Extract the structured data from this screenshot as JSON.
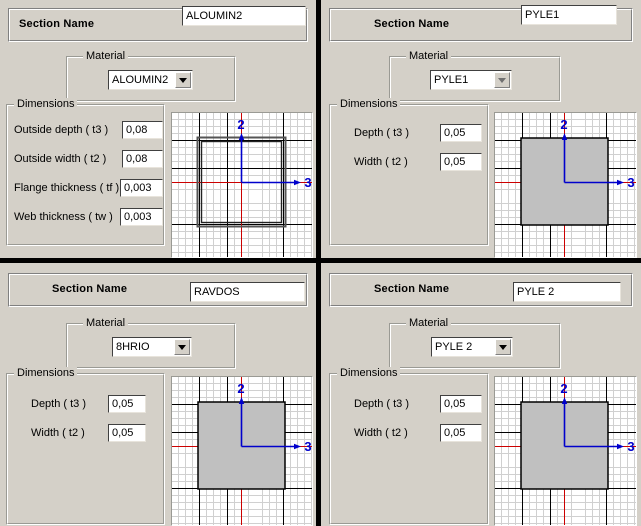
{
  "app": {
    "panel_count": 4,
    "background_color": "#d4d0c8",
    "divider_color": "#000000",
    "axis_label_color": "#0000c0",
    "shape_fill_color": "#c0c0c0"
  },
  "panels": [
    {
      "id": "top-left",
      "section_name_label": "Section Name",
      "section_name_value": "ALOUMIN2",
      "material": {
        "group_title": "Material",
        "selected": "ALOUMIN2",
        "arrow_icon": "chevron-down-icon"
      },
      "dimensions": {
        "group_title": "Dimensions",
        "rows": [
          {
            "label": "Outside depth  ( t3 )",
            "value": "0,08"
          },
          {
            "label": "Outside width  ( t2 )",
            "value": "0,08"
          },
          {
            "label": "Flange thickness  ( tf )",
            "value": "0,003"
          },
          {
            "label": "Web thickness  ( tw )",
            "value": "0,003"
          }
        ]
      },
      "preview": {
        "shape": "hollow-rectangle",
        "axis_2_label": "2",
        "axis_3_label": "3"
      }
    },
    {
      "id": "top-right",
      "section_name_label": "Section Name",
      "section_name_value": "PYLE1",
      "material": {
        "group_title": "Material",
        "selected": "PYLE1",
        "arrow_icon": "chevron-down-icon"
      },
      "dimensions": {
        "group_title": "Dimensions",
        "rows": [
          {
            "label": "Depth  ( t3 )",
            "value": "0,05"
          },
          {
            "label": "Width  ( t2 )",
            "value": "0,05"
          }
        ]
      },
      "preview": {
        "shape": "solid-rectangle",
        "axis_2_label": "2",
        "axis_3_label": "3"
      }
    },
    {
      "id": "bottom-left",
      "section_name_label": "Section Name",
      "section_name_value": "RAVDOS",
      "material": {
        "group_title": "Material",
        "selected": "8HRIO",
        "arrow_icon": "chevron-down-icon"
      },
      "dimensions": {
        "group_title": "Dimensions",
        "rows": [
          {
            "label": "Depth  ( t3 )",
            "value": "0,05"
          },
          {
            "label": "Width  ( t2 )",
            "value": "0,05"
          }
        ]
      },
      "preview": {
        "shape": "solid-rectangle",
        "axis_2_label": "2",
        "axis_3_label": "3"
      }
    },
    {
      "id": "bottom-right",
      "section_name_label": "Section Name",
      "section_name_value": "PYLE 2",
      "material": {
        "group_title": "Material",
        "selected": "PYLE 2",
        "arrow_icon": "chevron-down-icon"
      },
      "dimensions": {
        "group_title": "Dimensions",
        "rows": [
          {
            "label": "Depth  ( t3 )",
            "value": "0,05"
          },
          {
            "label": "Width  ( t2 )",
            "value": "0,05"
          }
        ]
      },
      "preview": {
        "shape": "solid-rectangle",
        "axis_2_label": "2",
        "axis_3_label": "3"
      }
    }
  ]
}
